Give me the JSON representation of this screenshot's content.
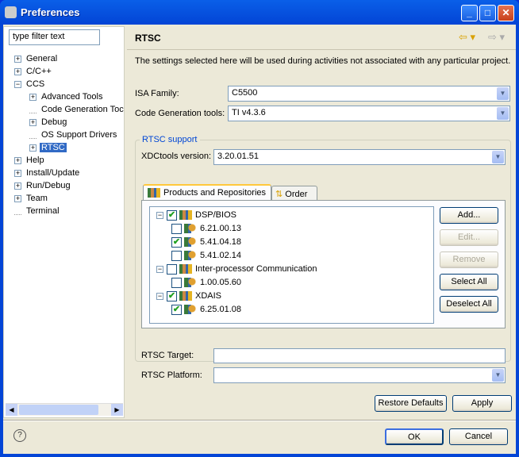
{
  "window": {
    "title": "Preferences",
    "minimize": "_",
    "maximize": "□",
    "close": "✕"
  },
  "sidebar": {
    "filter_placeholder": "type filter text",
    "items": [
      {
        "label": "General",
        "expander": "+"
      },
      {
        "label": "C/C++",
        "expander": "+"
      },
      {
        "label": "CCS",
        "expander": "−"
      },
      {
        "label": "Advanced Tools",
        "expander": "+"
      },
      {
        "label": "Code Generation Toc",
        "expander": ""
      },
      {
        "label": "Debug",
        "expander": "+"
      },
      {
        "label": "OS Support Drivers",
        "expander": ""
      },
      {
        "label": "RTSC",
        "expander": "+",
        "selected": true
      },
      {
        "label": "Help",
        "expander": "+"
      },
      {
        "label": "Install/Update",
        "expander": "+"
      },
      {
        "label": "Run/Debug",
        "expander": "+"
      },
      {
        "label": "Team",
        "expander": "+"
      },
      {
        "label": "Terminal",
        "expander": ""
      }
    ]
  },
  "page": {
    "title": "RTSC",
    "back": "⇦ ▾",
    "forward": "⇨ ▾",
    "description": "The settings selected here will be used during activities not associated with any particular project.",
    "isa_label": "ISA Family:",
    "isa_value": "C5500",
    "codegen_label": "Code Generation tools:",
    "codegen_value": "TI v4.3.6",
    "group_label": "RTSC support",
    "xdc_label": "XDCtools version:",
    "xdc_value": "3.20.01.51",
    "tabs": [
      "Products and Repositories",
      "Order"
    ],
    "products": [
      {
        "label": "DSP/BIOS",
        "checked": true,
        "children": [
          {
            "label": "6.21.00.13",
            "checked": false
          },
          {
            "label": "5.41.04.18",
            "checked": true
          },
          {
            "label": "5.41.02.14",
            "checked": false
          }
        ]
      },
      {
        "label": "Inter-processor Communication",
        "checked": false,
        "children": [
          {
            "label": "1.00.05.60",
            "checked": false
          }
        ]
      },
      {
        "label": "XDAIS",
        "checked": true,
        "children": [
          {
            "label": "6.25.01.08",
            "checked": true
          }
        ]
      }
    ],
    "buttons": {
      "add": "Add...",
      "edit": "Edit...",
      "remove": "Remove",
      "select_all": "Select All",
      "deselect_all": "Deselect All"
    },
    "target_label": "RTSC Target:",
    "target_value": "",
    "platform_label": "RTSC Platform:",
    "platform_value": "",
    "restore": "Restore Defaults",
    "apply": "Apply"
  },
  "footer": {
    "help": "?",
    "ok": "OK",
    "cancel": "Cancel"
  }
}
